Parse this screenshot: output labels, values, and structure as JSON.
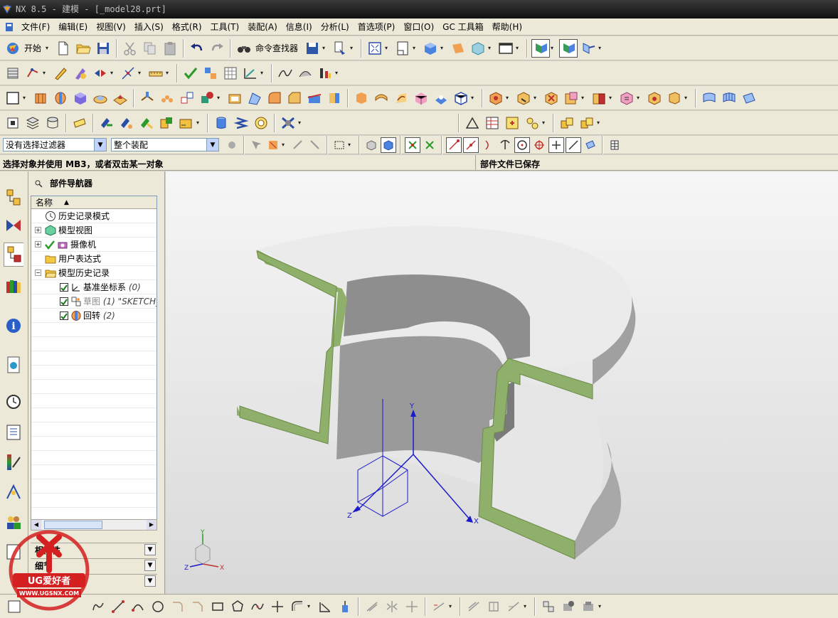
{
  "window": {
    "title": "NX 8.5 - 建模 - [_model28.prt]"
  },
  "menu": {
    "items": [
      "文件(F)",
      "编辑(E)",
      "视图(V)",
      "插入(S)",
      "格式(R)",
      "工具(T)",
      "装配(A)",
      "信息(I)",
      "分析(L)",
      "首选项(P)",
      "窗口(O)",
      "GC 工具箱",
      "帮助(H)"
    ]
  },
  "toolbar1": {
    "start_label": "开始",
    "command_finder_label": "命令查找器"
  },
  "selection": {
    "filter_value": "没有选择过滤器",
    "scope_value": "整个装配"
  },
  "status": {
    "prompt": "选择对象并使用 MB3，或者双击某一对象",
    "message": "部件文件已保存"
  },
  "navigator": {
    "title": "部件导航器",
    "column_header": "名称",
    "rows": [
      {
        "label": "历史记录模式",
        "index": ""
      },
      {
        "label": "模型视图",
        "index": ""
      },
      {
        "label": "摄像机",
        "index": ""
      },
      {
        "label": "用户表达式",
        "index": ""
      },
      {
        "label": "模型历史记录",
        "index": ""
      },
      {
        "label": "基准坐标系",
        "index": "(0)"
      },
      {
        "label": "草图",
        "index": "(1) \"SKETCH_"
      },
      {
        "label": "回转",
        "index": "(2)"
      }
    ],
    "sections": [
      "相依性",
      "细节",
      "预览"
    ]
  },
  "viewport": {
    "axes": {
      "x": "X",
      "y": "Y",
      "z": "Z"
    },
    "colors": {
      "section_face": "#8fb06a",
      "body": "#e6e6e6",
      "csys": "#1a1acc"
    }
  },
  "watermark": {
    "brand_text": "UG爱好者",
    "url": "WWW.UGSNX.COM"
  }
}
